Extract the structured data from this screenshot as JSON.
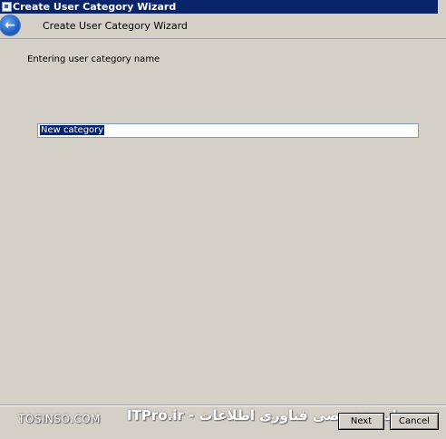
{
  "window": {
    "title": "Create User Category Wizard"
  },
  "header": {
    "title": "Create User Category Wizard"
  },
  "main": {
    "heading": "Entering user category name",
    "name_input": {
      "value": "New category"
    }
  },
  "footer": {
    "watermark_left": "TOSINSO.COM",
    "watermark_right": "ITPro.ir - وب سایت تخصصی فناوری اطلاعات",
    "next_label": "Next",
    "cancel_label": "Cancel"
  }
}
